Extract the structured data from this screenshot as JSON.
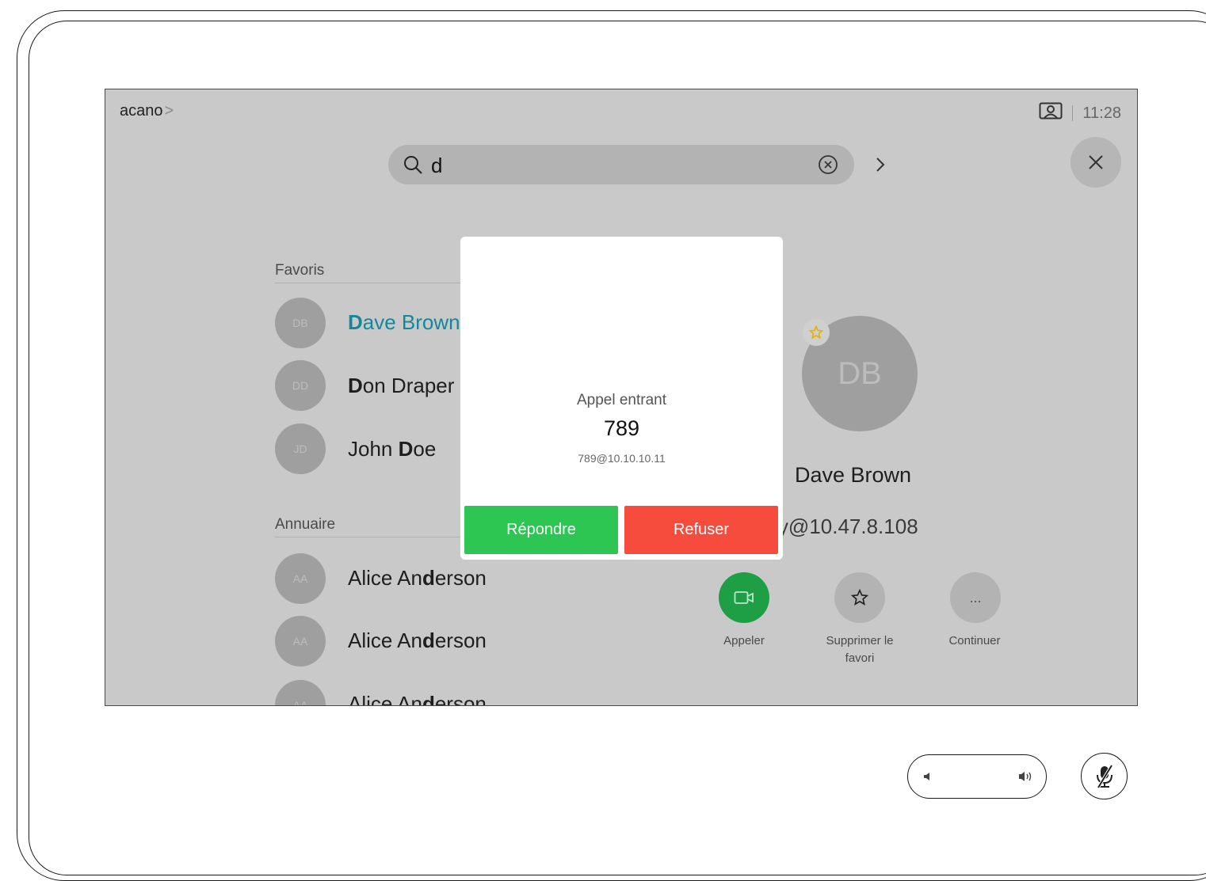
{
  "status_bar": {
    "system_name": "acano",
    "chevron": ">",
    "time": "11:28"
  },
  "search": {
    "query": "d"
  },
  "favorites": {
    "label": "Favoris",
    "items": [
      {
        "initials": "DB",
        "match": "D",
        "rest": "ave Brown",
        "pre": ""
      },
      {
        "initials": "DD",
        "match": "D",
        "rest": "on Draper",
        "pre": ""
      },
      {
        "initials": "JD",
        "pre": "John ",
        "match": "D",
        "rest": "oe"
      }
    ]
  },
  "directory": {
    "label": "Annuaire",
    "items": [
      {
        "initials": "AA",
        "pre": "Alice An",
        "match": "d",
        "rest": "erson"
      },
      {
        "initials": "AA",
        "pre": "Alice An",
        "match": "d",
        "rest": "erson"
      },
      {
        "initials": "AA",
        "pre": "Alice An",
        "match": "d",
        "rest": "erson"
      }
    ]
  },
  "contact_detail": {
    "initials": "DB",
    "name": "Dave Brown",
    "uri": "nny@10.47.8.108",
    "actions": {
      "call": "Appeler",
      "remove_favorite_line1": "Supprimer le",
      "remove_favorite_line2": "favori",
      "more": "Continuer",
      "more_glyph": "..."
    }
  },
  "incoming_call": {
    "title": "Appel entrant",
    "number": "789",
    "uri": "789@10.10.10.11",
    "answer_label": "Répondre",
    "decline_label": "Refuser"
  },
  "colors": {
    "accent": "#12889a",
    "answer_green": "#2dc653",
    "decline_red": "#f54c3e",
    "call_green": "#1e9e45",
    "favorite_star": "#e0b400"
  }
}
